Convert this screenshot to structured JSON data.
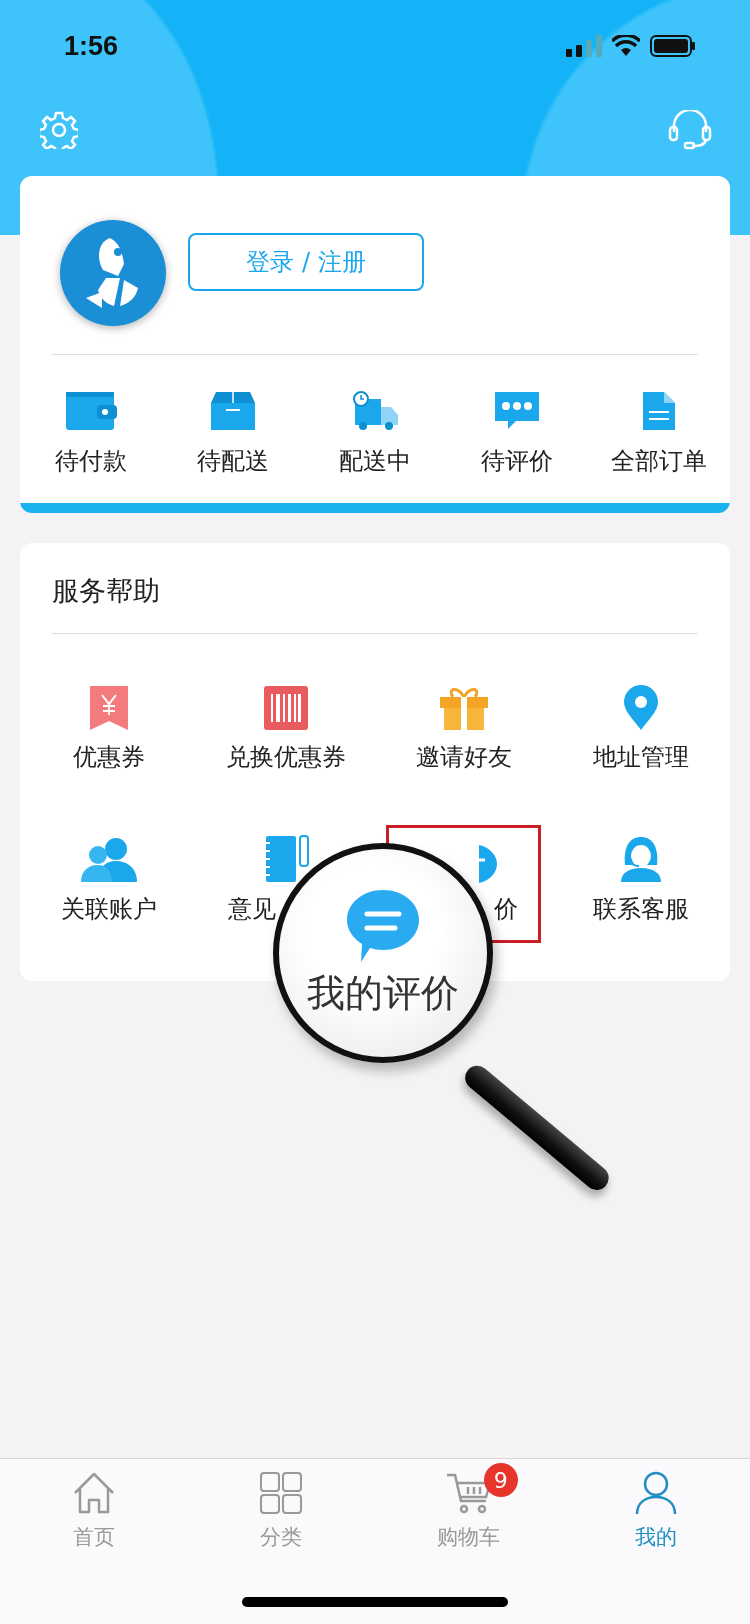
{
  "status_bar": {
    "time": "1:56"
  },
  "account": {
    "login_button": "登录 / 注册"
  },
  "orders": [
    {
      "label": "待付款"
    },
    {
      "label": "待配送"
    },
    {
      "label": "配送中"
    },
    {
      "label": "待评价"
    },
    {
      "label": "全部订单"
    }
  ],
  "services": {
    "title": "服务帮助",
    "items": [
      {
        "label": "优惠券"
      },
      {
        "label": "兑换优惠券"
      },
      {
        "label": "邀请好友"
      },
      {
        "label": "地址管理"
      },
      {
        "label": "关联账户"
      },
      {
        "label": "意见"
      },
      {
        "label": "价"
      },
      {
        "label": "联系客服"
      }
    ]
  },
  "magnifier": {
    "label": "我的评价"
  },
  "tabs": [
    {
      "label": "首页",
      "selected": false
    },
    {
      "label": "分类",
      "selected": false
    },
    {
      "label": "购物车",
      "selected": false,
      "badge": "9"
    },
    {
      "label": "我的",
      "selected": true
    }
  ]
}
